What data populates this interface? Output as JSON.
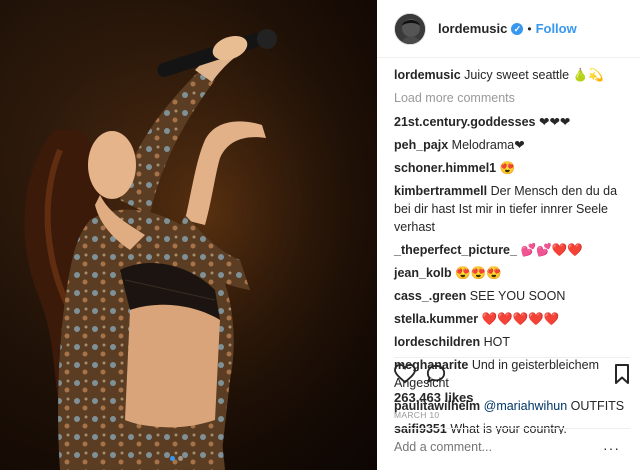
{
  "post": {
    "author": "lordemusic",
    "follow_label": "Follow",
    "dot": "•",
    "verified_glyph": "✓",
    "caption": {
      "user": "lordemusic",
      "text": "Juicy sweet seattle 🍐💫"
    },
    "load_more": "Load more comments",
    "comments": [
      {
        "user": "21st.century.goddesses",
        "text": "❤❤❤"
      },
      {
        "user": "peh_pajx",
        "text": "Melodrama❤"
      },
      {
        "user": "schoner.himmel1",
        "text": "😍"
      },
      {
        "user": "kimbertrammell",
        "text": "Der Mensch den du da bei dir hast Ist mir in tiefer innrer Seele verhast"
      },
      {
        "user": "_theperfect_picture_",
        "text": "💕💕❤️❤️"
      },
      {
        "user": "jean_kolb",
        "text": "😍😍😍"
      },
      {
        "user": "cass_.green",
        "text": "SEE YOU SOON"
      },
      {
        "user": "stella.kummer",
        "text": "❤️❤️❤️❤️❤️"
      },
      {
        "user": "lordeschildren",
        "text": "HOT"
      },
      {
        "user": "meghanarite",
        "text": "Und in geisterbleichem Angesicht"
      },
      {
        "user": "paulitawilhelm",
        "mention": "@mariahwihun",
        "text": "OUTFITS"
      },
      {
        "user": "saifi9351",
        "text": "What is your country."
      }
    ],
    "likes": "263,463 likes",
    "date": "MARCH 10",
    "add_comment_placeholder": "Add a comment...",
    "more_icon": "···"
  },
  "icons": {
    "like": "heart-icon",
    "comment": "comment-bubble-icon",
    "save": "bookmark-icon",
    "verified": "verified-badge-icon",
    "more": "more-options-icon"
  },
  "colors": {
    "accent": "#3897f0",
    "muted": "#999999",
    "text": "#262626"
  }
}
